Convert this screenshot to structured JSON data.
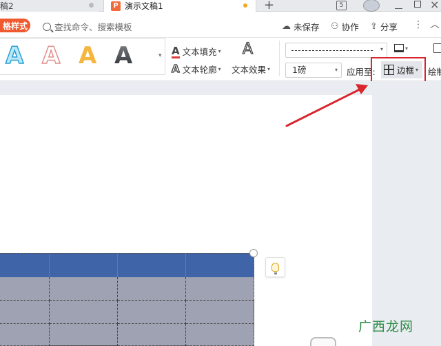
{
  "tabs": [
    {
      "label": "稿2",
      "active": false,
      "modified": true
    },
    {
      "label": "演示文稿1",
      "app_icon": "P",
      "active": true,
      "modified": true
    }
  ],
  "toolbar": {
    "style_tab_label": "格样式",
    "search_placeholder": "查找命令、搜索模板",
    "unsaved_label": "未保存",
    "collab_label": "协作",
    "share_label": "分享",
    "more_label": "⋮"
  },
  "ribbon": {
    "wordart_styles": [
      "A",
      "A",
      "A",
      "A"
    ],
    "text_fill_label": "文本填充",
    "text_outline_label": "文本轮廓",
    "text_effect_label": "文本效果",
    "line_weight_value": "1磅",
    "apply_to_label": "应用至:",
    "border_button_label": "边框",
    "draw_label": "绘制"
  },
  "watermark": {
    "text": "广西龙网"
  },
  "colors": {
    "accent_orange": "#f0582d",
    "highlight_red": "#d7262c",
    "table_header": "#3f64a7",
    "table_body": "#9ea2b2",
    "watermark_green": "#2a8a43"
  },
  "icons": {
    "search": "search-icon",
    "cloud": "cloud-icon",
    "collab": "person-add-icon",
    "share": "share-icon",
    "border": "table-border-icon",
    "tip": "lightbulb-icon"
  }
}
